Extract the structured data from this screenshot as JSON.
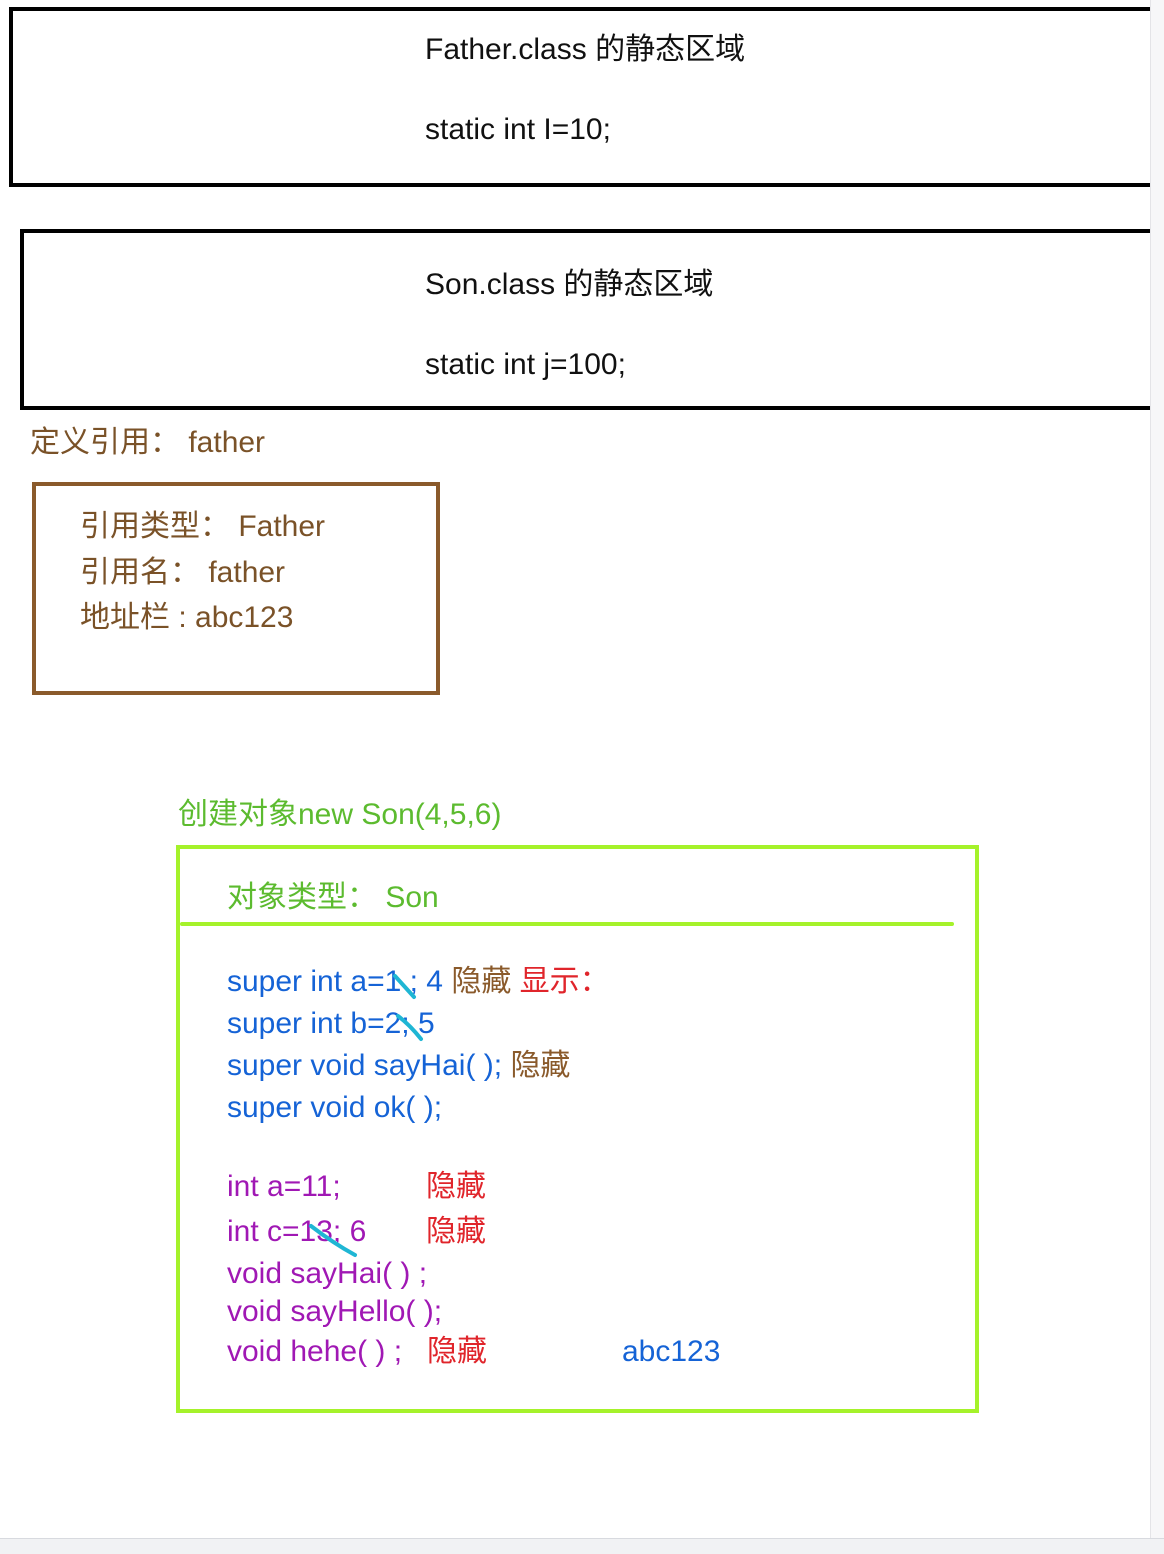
{
  "father_static": {
    "title": "Father.class 的静态区域",
    "field": "static int I=10;"
  },
  "son_static": {
    "title": "Son.class 的静态区域",
    "field": "static int j=100;"
  },
  "reference": {
    "title": "定义引用： father",
    "type_line": "引用类型： Father",
    "name_line": "引用名：  father",
    "address_line": "地址栏 : abc123"
  },
  "object": {
    "title": "创建对象new Son(4,5,6)",
    "type_line": "对象类型： Son",
    "super_a_prefix": "super int a=",
    "super_a_old": "1",
    "super_a_new": " ; 4 ",
    "super_a_hidden": "隐藏",
    "super_a_shown": " 显示：",
    "super_b_prefix": "super int b=",
    "super_b_old": "2",
    "super_b_new": "; 5",
    "super_sayhai": "super void sayHai( ); ",
    "super_sayhai_hidden": "隐藏",
    "super_ok": "super void ok( );",
    "int_a": "int a=11;",
    "int_a_hidden": "隐藏",
    "int_c_prefix": "int c=",
    "int_c_old": "13",
    "int_c_new": "; 6",
    "int_c_hidden": "隐藏",
    "void_sayhai": "void sayHai( ) ;",
    "void_sayhello": "void sayHello( );",
    "void_hehe": "void hehe( ) ;",
    "void_hehe_hidden": "隐藏",
    "address": "abc123"
  },
  "colors": {
    "static_border": "#000000",
    "reference": "#8a5a2b",
    "object_border": "#a5f22a",
    "object_title": "#5cbb2f",
    "super_members": "#1563d6",
    "son_members": "#a018b4",
    "hidden_label": "#e0252b",
    "strike_mark": "#1fb6d4"
  }
}
